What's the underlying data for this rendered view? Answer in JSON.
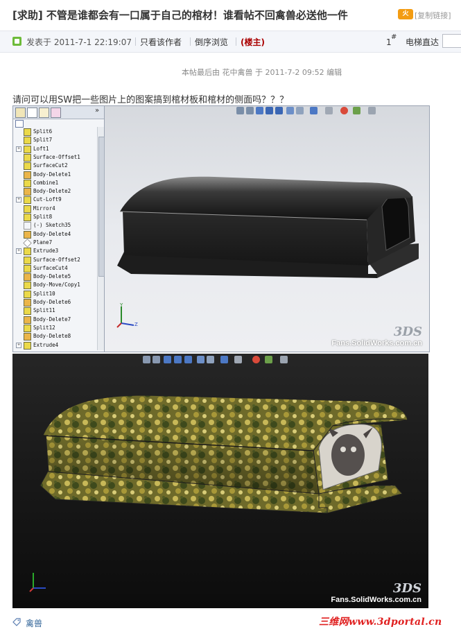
{
  "thread": {
    "title": "[求助] 不管是谁都会有一口属于自己的棺材！谁看帖不回禽兽必送他一件",
    "hot_label": "火",
    "copy_link": "[复制链接]"
  },
  "meta": {
    "posted": "发表于 2011-7-1 22:19:07",
    "only_author": "只看该作者",
    "reverse": "倒序浏览",
    "owner": "(楼主)",
    "floor": "1",
    "floor_symbol": "#",
    "elevator": "电梯直达"
  },
  "post": {
    "edit_note": "本帖最后由 花中禽兽 于 2011-7-2 09:52 编辑",
    "question": "请问可以用SW把一些图片上的图案搞到棺材板和棺材的侧面吗？？？"
  },
  "feature_tree": {
    "items": [
      {
        "label": "Split6",
        "icon": "split-icon",
        "expand": false
      },
      {
        "label": "Split7",
        "icon": "split-icon",
        "expand": false
      },
      {
        "label": "Loft1",
        "icon": "loft-icon",
        "expand": true
      },
      {
        "label": "Surface-Offset1",
        "icon": "surface-icon",
        "expand": false
      },
      {
        "label": "SurfaceCut2",
        "icon": "surface-icon",
        "expand": false
      },
      {
        "label": "Body-Delete1",
        "icon": "delete-icon",
        "expand": false
      },
      {
        "label": "Combine1",
        "icon": "combine-icon",
        "expand": false
      },
      {
        "label": "Body-Delete2",
        "icon": "delete-icon",
        "expand": false
      },
      {
        "label": "Cut-Loft9",
        "icon": "cut-icon",
        "expand": true
      },
      {
        "label": "Mirror4",
        "icon": "mirror-icon",
        "expand": false
      },
      {
        "label": "Split8",
        "icon": "split-icon",
        "expand": false
      },
      {
        "label": "(-) Sketch35",
        "icon": "sketch-icon",
        "expand": false
      },
      {
        "label": "Body-Delete4",
        "icon": "delete-icon",
        "expand": false
      },
      {
        "label": "Plane7",
        "icon": "plane-icon",
        "expand": false
      },
      {
        "label": "Extrude3",
        "icon": "extrude-icon",
        "expand": true
      },
      {
        "label": "Surface-Offset2",
        "icon": "surface-icon",
        "expand": false
      },
      {
        "label": "SurfaceCut4",
        "icon": "surface-icon",
        "expand": false
      },
      {
        "label": "Body-Delete5",
        "icon": "delete-icon",
        "expand": false
      },
      {
        "label": "Body-Move/Copy1",
        "icon": "move-icon",
        "expand": false
      },
      {
        "label": "Split10",
        "icon": "split-icon",
        "expand": false
      },
      {
        "label": "Body-Delete6",
        "icon": "delete-icon",
        "expand": false
      },
      {
        "label": "Split11",
        "icon": "split-icon",
        "expand": false
      },
      {
        "label": "Body-Delete7",
        "icon": "delete-icon",
        "expand": false
      },
      {
        "label": "Split12",
        "icon": "split-icon",
        "expand": false
      },
      {
        "label": "Body-Delete8",
        "icon": "delete-icon",
        "expand": false
      },
      {
        "label": "Extrude4",
        "icon": "extrude-icon",
        "expand": true
      }
    ]
  },
  "viewports": {
    "logo_text": "Fans.SolidWorks.com.cn",
    "axis_y": "Y",
    "axis_z": "Z"
  },
  "footer": {
    "author_tag": "禽兽",
    "watermark": "三维网www.3dportal.cn"
  },
  "colors": {
    "link": "#336699",
    "owner": "#aa0000",
    "watermark": "#e02020"
  }
}
